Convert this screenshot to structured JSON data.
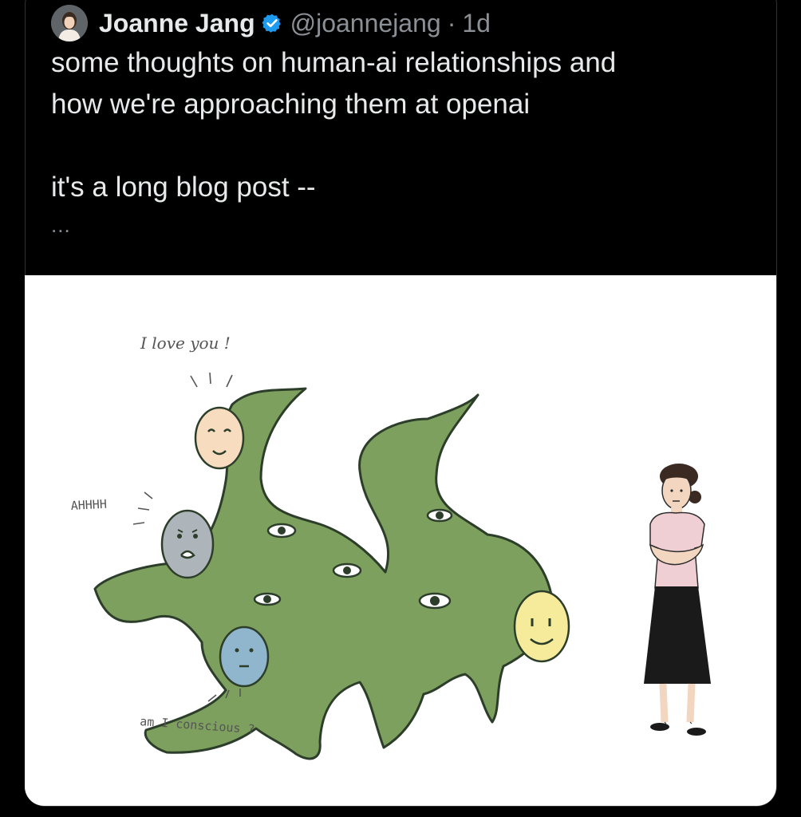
{
  "tweet": {
    "author_name": "Joanne Jang",
    "handle": "@joannejang",
    "separator": "·",
    "timestamp": "1d",
    "text": "some thoughts on human-ai relationships and\nhow we're approaching them at openai\n\nit's a long blog post --",
    "more_indicator": "...",
    "icons": {
      "verified": "verified-badge-icon",
      "avatar": "profile-avatar"
    },
    "colors": {
      "verified": "#1d9bf0",
      "background": "#000000",
      "text": "#e7e9ea",
      "muted": "#8b9096"
    }
  },
  "illustration": {
    "top_label": "I love you !",
    "left_label": "AHHHH",
    "bottom_label": "am I conscious ?",
    "colors": {
      "creature": "#7ea05f",
      "outline": "#2c3e2a",
      "face_orange": "#f7dcc0",
      "face_gray": "#aeb5ba",
      "face_blue": "#8fb6cd",
      "face_yellow": "#f5eb9a",
      "shirt": "#f0cfd4",
      "skirt": "#1a1a1a"
    }
  }
}
